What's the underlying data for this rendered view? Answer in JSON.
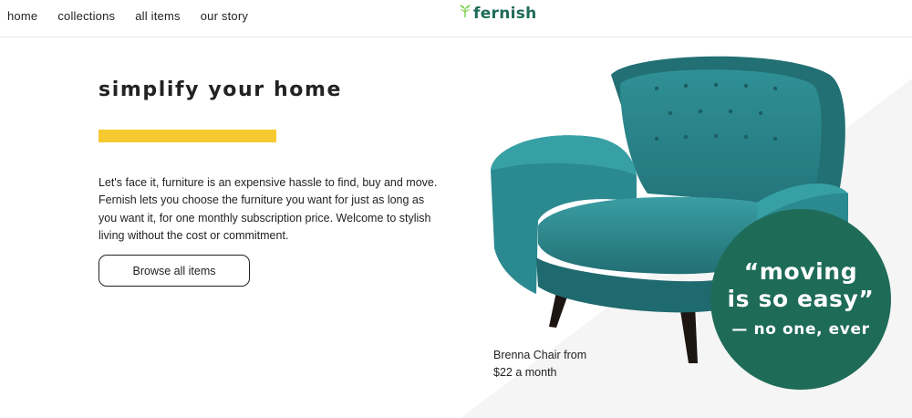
{
  "nav": {
    "items": [
      {
        "label": "home"
      },
      {
        "label": "collections"
      },
      {
        "label": "all items"
      },
      {
        "label": "our story"
      }
    ]
  },
  "brand": {
    "name": "fernish",
    "color": "#1e6b58",
    "leaf_color": "#6ecf3a"
  },
  "hero": {
    "title": "simplify your home",
    "accent_color": "#f6c931",
    "body": "Let's face it, furniture is an expensive hassle to find, buy and move. Fernish lets you choose the furniture you want for just as long as you want it, for one monthly subscription price. Welcome to stylish living without the cost or commitment.",
    "cta_label": "Browse all items"
  },
  "product": {
    "caption_line1": "Brenna Chair from",
    "caption_line2": "$22 a month",
    "image_icon": "armchair-image",
    "upholstery_color": "#2c8a8f"
  },
  "quote": {
    "line1": "“moving",
    "line2": "is so easy”",
    "attribution": "— no one, ever",
    "bg_color": "#1e6b58"
  }
}
